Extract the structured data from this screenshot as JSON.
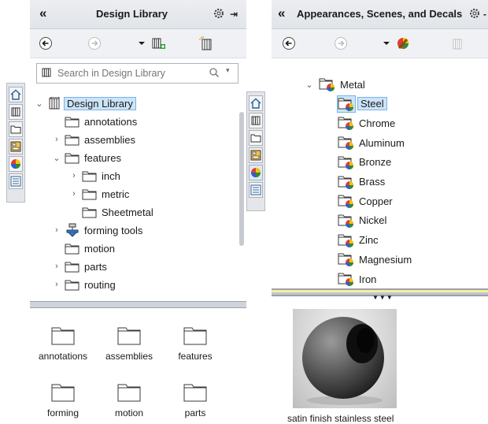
{
  "left_panel": {
    "title": "Design Library",
    "collapse_glyph": "«",
    "search_placeholder": "Search in Design Library",
    "tree": [
      {
        "label": "Design Library",
        "level": 0,
        "expander": "⌄",
        "icon": "design-library-icon",
        "selected": true
      },
      {
        "label": "annotations",
        "level": 1,
        "expander": "",
        "icon": "folder-icon"
      },
      {
        "label": "assemblies",
        "level": 1,
        "expander": "›",
        "icon": "folder-icon"
      },
      {
        "label": "features",
        "level": 1,
        "expander": "⌄",
        "icon": "folder-icon"
      },
      {
        "label": "inch",
        "level": 2,
        "expander": "›",
        "icon": "folder-icon"
      },
      {
        "label": "metric",
        "level": 2,
        "expander": "›",
        "icon": "folder-icon"
      },
      {
        "label": "Sheetmetal",
        "level": 2,
        "expander": "",
        "icon": "folder-icon"
      },
      {
        "label": "forming tools",
        "level": 1,
        "expander": "›",
        "icon": "forming-tools-icon"
      },
      {
        "label": "motion",
        "level": 1,
        "expander": "",
        "icon": "folder-icon"
      },
      {
        "label": "parts",
        "level": 1,
        "expander": "›",
        "icon": "folder-icon"
      },
      {
        "label": "routing",
        "level": 1,
        "expander": "›",
        "icon": "folder-icon"
      }
    ],
    "grid": [
      {
        "label": "annotations"
      },
      {
        "label": "assemblies"
      },
      {
        "label": "features"
      },
      {
        "label": "forming"
      },
      {
        "label": "motion"
      },
      {
        "label": "parts"
      }
    ]
  },
  "right_panel": {
    "title": "Appearances, Scenes, and Decals",
    "collapse_glyph": "«",
    "tree": [
      {
        "label": "Metal",
        "level": 0,
        "expander": "⌄",
        "selected": false
      },
      {
        "label": "Steel",
        "level": 1,
        "expander": "",
        "selected": true
      },
      {
        "label": "Chrome",
        "level": 1,
        "expander": "",
        "selected": false
      },
      {
        "label": "Aluminum",
        "level": 1,
        "expander": "",
        "selected": false
      },
      {
        "label": "Bronze",
        "level": 1,
        "expander": "",
        "selected": false
      },
      {
        "label": "Brass",
        "level": 1,
        "expander": "",
        "selected": false
      },
      {
        "label": "Copper",
        "level": 1,
        "expander": "",
        "selected": false
      },
      {
        "label": "Nickel",
        "level": 1,
        "expander": "",
        "selected": false
      },
      {
        "label": "Zinc",
        "level": 1,
        "expander": "",
        "selected": false
      },
      {
        "label": "Magnesium",
        "level": 1,
        "expander": "",
        "selected": false
      },
      {
        "label": "Iron",
        "level": 1,
        "expander": "",
        "selected": false
      }
    ],
    "preview_caption": "satin finish stainless steel"
  },
  "colors": {
    "selection_bg": "#cce4f7",
    "selection_border": "#7ab4e6",
    "folder_outline": "#3a3a3a",
    "titlebar": "#e6e8eb"
  }
}
